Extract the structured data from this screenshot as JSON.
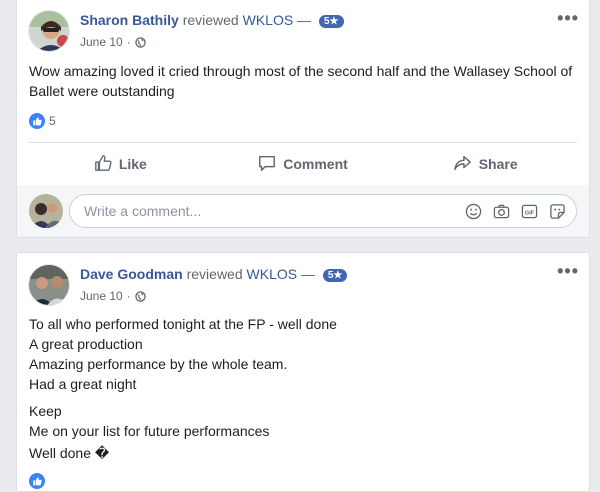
{
  "posts": [
    {
      "author": "Sharon Bathily",
      "action": "reviewed",
      "page": "WKLOS",
      "separator": "—",
      "rating_badge": "5★",
      "date": "June 10",
      "dot": "·",
      "body_lines": [
        "Wow amazing loved it cried through most of the second half and the Wallasey School of Ballet were outstanding"
      ],
      "reaction_count": "5",
      "actions": {
        "like": "Like",
        "comment": "Comment",
        "share": "Share"
      },
      "comment_placeholder": "Write a comment..."
    },
    {
      "author": "Dave Goodman",
      "action": "reviewed",
      "page": "WKLOS",
      "separator": "—",
      "rating_badge": "5★",
      "date": "June 10",
      "dot": "·",
      "paragraph1": [
        "To all who performed tonight at the FP - well done",
        "A great production",
        "Amazing performance by the whole team.",
        "Had a great night"
      ],
      "paragraph2": [
        "Keep",
        "Me on your list for future performances",
        "Well done �"
      ]
    }
  ],
  "more_glyph": "•••",
  "colors": {
    "link": "#385898",
    "badge": "#4267b2",
    "like": "#3b82f6",
    "muted": "#606770"
  }
}
